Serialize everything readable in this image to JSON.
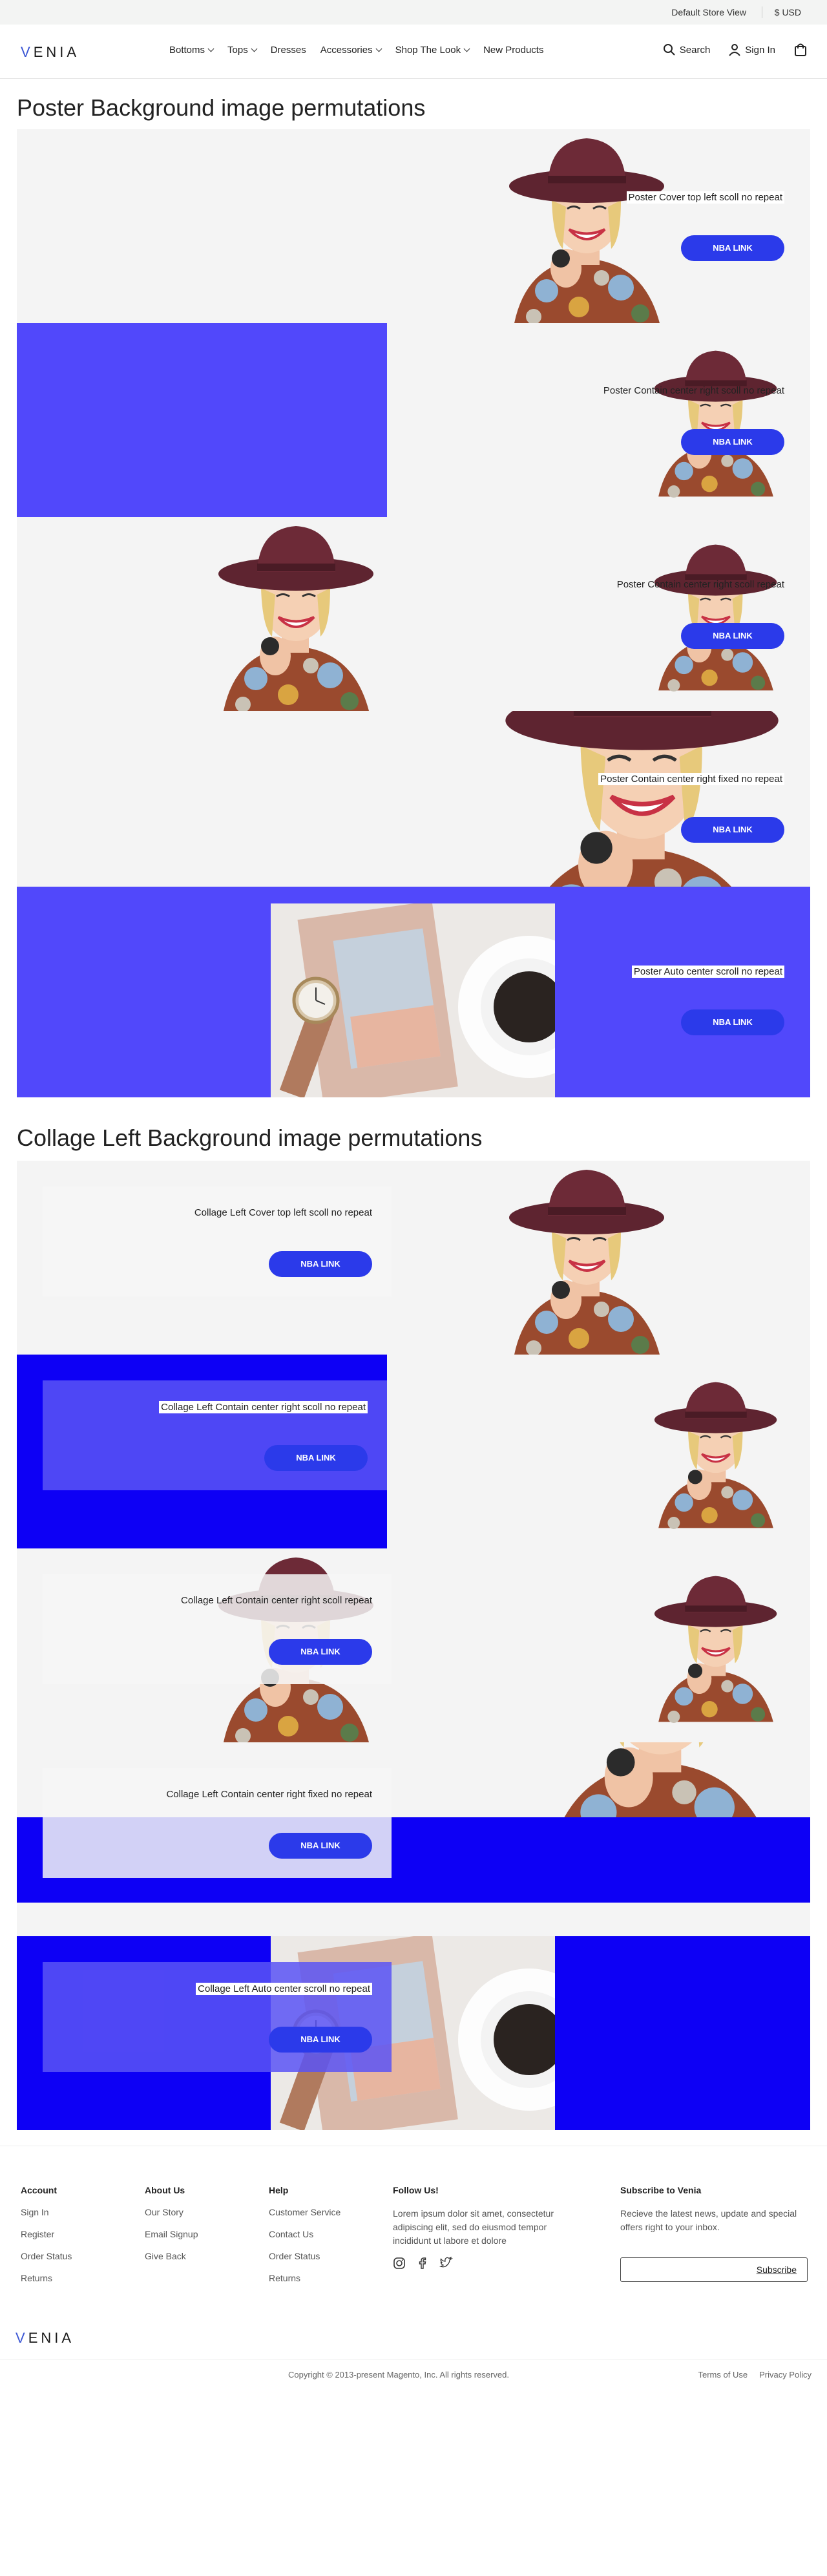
{
  "topbar": {
    "store": "Default Store View",
    "currency": "$ USD"
  },
  "header": {
    "logo": "VENIA",
    "nav": [
      {
        "label": "Bottoms",
        "dropdown": true
      },
      {
        "label": "Tops",
        "dropdown": true
      },
      {
        "label": "Dresses",
        "dropdown": false
      },
      {
        "label": "Accessories",
        "dropdown": true
      },
      {
        "label": "Shop The Look",
        "dropdown": true
      },
      {
        "label": "New Products",
        "dropdown": false
      }
    ],
    "search_label": "Search",
    "signin_label": "Sign In"
  },
  "poster": {
    "title": "Poster Background image permutations",
    "banners": [
      {
        "caption": "Poster Cover top left scoll no repeat",
        "button": "NBA LINK"
      },
      {
        "caption": "Poster Contain center right scoll no repeat",
        "button": "NBA LINK"
      },
      {
        "caption": "Poster Contain center right scoll repeat",
        "button": "NBA LINK"
      },
      {
        "caption": "Poster Contain center right fixed no repeat",
        "button": "NBA LINK"
      },
      {
        "caption": "Poster Auto center  scroll no repeat",
        "button": "NBA LINK"
      }
    ]
  },
  "collage": {
    "title": "Collage Left Background image permutations",
    "banners": [
      {
        "caption": "Collage Left Cover top left scoll no repeat",
        "button": "NBA LINK"
      },
      {
        "caption": "Collage Left Contain center right scoll no repeat",
        "button": "NBA LINK"
      },
      {
        "caption": "Collage Left Contain center right scoll repeat",
        "button": "NBA LINK"
      },
      {
        "caption": "Collage Left Contain center right fixed no repeat",
        "button": "NBA LINK"
      },
      {
        "caption": "Collage Left Auto center  scroll no repeat",
        "button": "NBA LINK"
      }
    ]
  },
  "footer": {
    "account": {
      "title": "Account",
      "links": [
        "Sign In",
        "Register",
        "Order Status",
        "Returns"
      ]
    },
    "about": {
      "title": "About Us",
      "links": [
        "Our Story",
        "Email Signup",
        "Give Back"
      ]
    },
    "help": {
      "title": "Help",
      "links": [
        "Customer Service",
        "Contact Us",
        "Order Status",
        "Returns"
      ]
    },
    "follow": {
      "title": "Follow Us!",
      "text": "Lorem ipsum dolor sit amet, consectetur adipiscing elit, sed do eiusmod tempor incididunt ut labore et dolore"
    },
    "subscribe": {
      "title": "Subscribe to Venia",
      "text": "Recieve the latest news, update and special offers right to your inbox.",
      "button": "Subscribe"
    },
    "logo": "VENIA",
    "copyright": "Copyright © 2013-present Magento, Inc. All rights reserved.",
    "terms": "Terms of Use",
    "privacy": "Privacy Policy"
  },
  "colors": {
    "accent": "#2b3aea",
    "panel_blue": "#5148fb",
    "deep_blue": "#0d00f5",
    "panel_grey": "#f4f4f4"
  }
}
